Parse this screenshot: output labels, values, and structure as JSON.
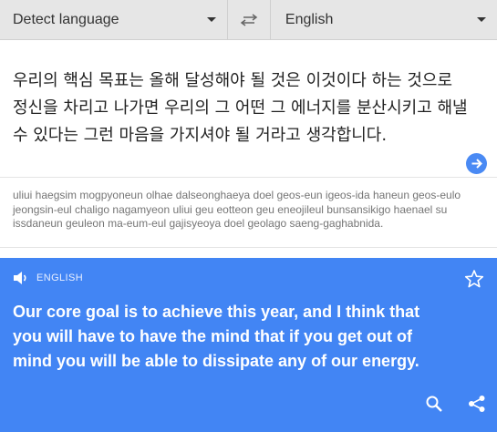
{
  "languages": {
    "source_label": "Detect language",
    "target_label": "English"
  },
  "source": {
    "text": "우리의 핵심 목표는 올해 달성해야 될 것은 이것이다 하는 것으로 정신을 차리고 나가면 우리의 그 어떤 그 에너지를 분산시키고 해낼 수 있다는 그런 마음을 가지셔야 될 거라고 생각합니다."
  },
  "transliteration": {
    "text": "uliui haegsim mogpyoneun olhae dalseonghaeya doel geos-eun igeos-ida haneun geos-eulo jeongsin-eul chaligo nagamyeon uliui geu eotteon geu eneojileul bunsansikigo haenael su issdaneun geuleon ma-eum-eul gajisyeoya doel geolago saeng-gaghabnida."
  },
  "result": {
    "lang_label": "ENGLISH",
    "text": "Our core goal is to achieve this year, and I think that you will have to have the mind that if you get out of mind you will be able to dissipate any of our energy."
  },
  "colors": {
    "accent": "#4285f4",
    "topbar": "#e6e6e6",
    "go_button": "#4a8af4"
  },
  "icons": {
    "swap": "swap-arrows-icon",
    "go": "arrow-right-icon",
    "speaker": "speaker-icon",
    "star": "star-icon",
    "search": "search-icon",
    "share": "share-icon"
  }
}
